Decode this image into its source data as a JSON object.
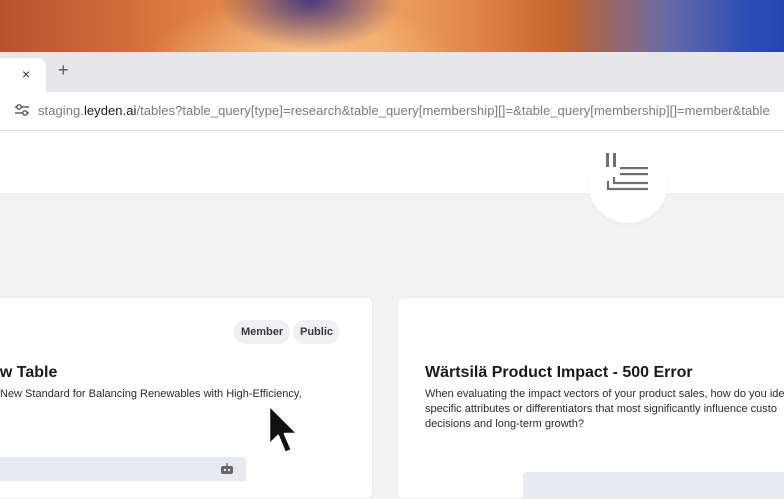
{
  "browser": {
    "tab_close": "×",
    "new_tab": "+",
    "url_prefix": "staging.",
    "url_host": "leyden.ai",
    "url_path": "/tables?table_query[type]=research&table_query[membership][]=&table_query[membership][]=member&table"
  },
  "cards": [
    {
      "badges": [
        "Member",
        "Public"
      ],
      "title": "ew Table",
      "description": "New Standard for Balancing Renewables with High-Efficiency,"
    },
    {
      "title": "Wärtsilä Product Impact - 500 Error",
      "description": "When evaluating the impact vectors of your product sales, how do you ide specific attributes or differentiators that most significantly influence custo decisions and long-term growth?"
    }
  ],
  "icons": {
    "site_settings": "tune-icon",
    "logo": "leyden-logo-icon",
    "preview": "robot-icon",
    "cursor": "mouse-pointer-icon"
  }
}
